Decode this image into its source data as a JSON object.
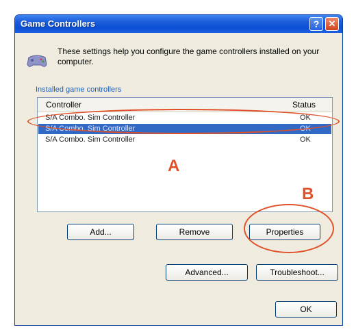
{
  "window": {
    "title": "Game Controllers"
  },
  "titlebar_buttons": {
    "help": "?",
    "close": "✕"
  },
  "description": "These settings help you configure the game controllers installed on your computer.",
  "group_label": "Installed game controllers",
  "list": {
    "columns": [
      "Controller",
      "Status"
    ],
    "rows": [
      {
        "controller": "S/A Combo. Sim Controller",
        "status": "OK"
      },
      {
        "controller": "S/A Combo. Sim Controller",
        "status": "OK"
      },
      {
        "controller": "S/A Combo. Sim Controller",
        "status": "OK"
      }
    ],
    "selected_index": 1
  },
  "annotations": {
    "a": "A",
    "b": "B",
    "color": "#e0512a"
  },
  "buttons": {
    "add": "Add...",
    "remove": "Remove",
    "properties": "Properties",
    "advanced": "Advanced...",
    "troubleshoot": "Troubleshoot...",
    "ok": "OK"
  },
  "colors": {
    "titlebar": "#0b4fd6",
    "selection": "#316ac5",
    "annotation": "#e0512a"
  }
}
